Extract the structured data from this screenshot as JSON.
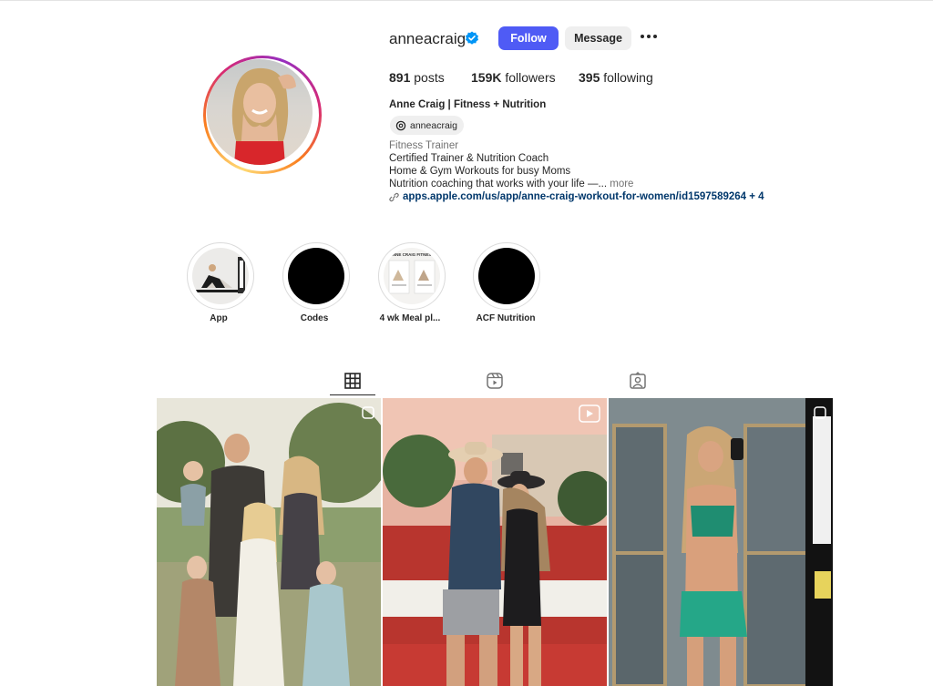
{
  "profile": {
    "username": "anneacraig",
    "follow_label": "Follow",
    "message_label": "Message",
    "posts_count": "891",
    "posts_label": "posts",
    "followers_count": "159K",
    "followers_label": "followers",
    "following_count": "395",
    "following_label": "following",
    "full_name": "Anne Craig | Fitness + Nutrition",
    "threads_handle": "anneacraig",
    "category": "Fitness Trainer",
    "bio_line1": "Certified Trainer & Nutrition Coach",
    "bio_line2": "Home & Gym Workouts for busy Moms",
    "bio_line3": "Nutrition coaching that works with your life —...",
    "more_label": "more",
    "link": "apps.apple.com/us/app/anne-craig-workout-for-women/id1597589264 + 4"
  },
  "highlights": [
    {
      "label": "App"
    },
    {
      "label": "Codes"
    },
    {
      "label": "4 wk Meal pl..."
    },
    {
      "label": "ACF Nutrition"
    }
  ],
  "highlight_thumb_text": "ANNE CRAIG FITNESS",
  "tabs": [
    "posts-grid",
    "reels",
    "tagged"
  ],
  "colors": {
    "follow_button": "#4f5bf5",
    "verified_badge": "#0095f6",
    "link": "#00376b"
  }
}
